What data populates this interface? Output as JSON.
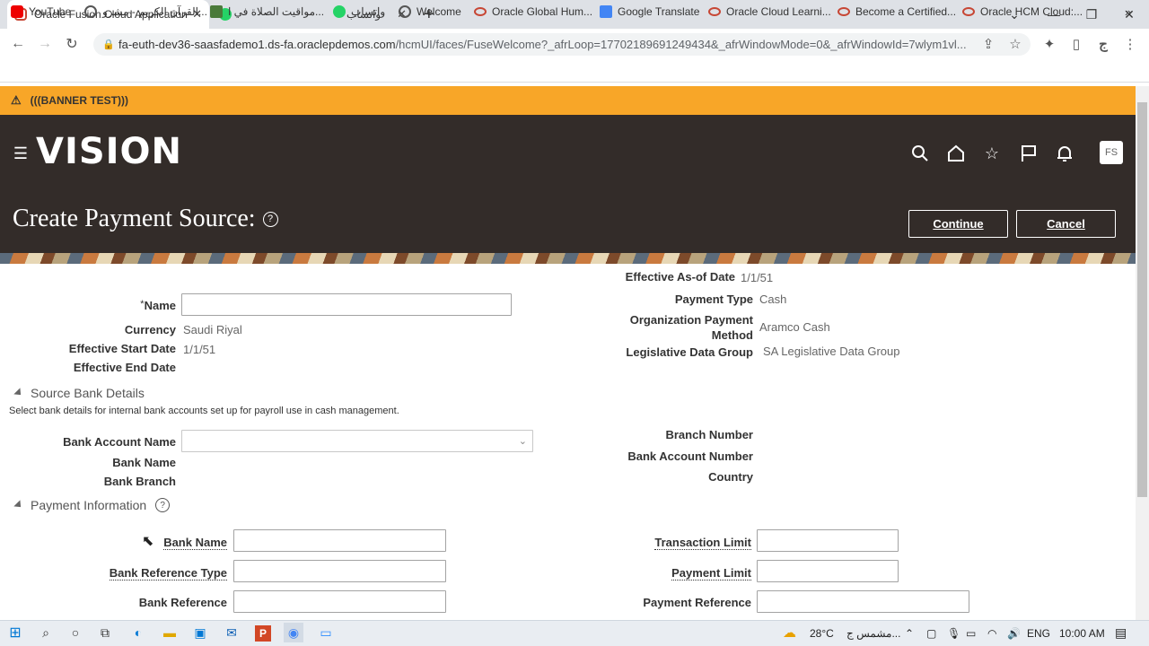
{
  "browser": {
    "tabs": [
      {
        "title": "Oracle Fusion Cloud Applications",
        "active": true
      },
      {
        "title": "واتساب",
        "active": false
      }
    ],
    "new_tab": "+",
    "url_host": "fa-euth-dev36-saasfademo1.ds-fa.oraclepdemos.com",
    "url_path": "/hcmUI/faces/FuseWelcome?_afrLoop=17702189691249434&_afrWindowMode=0&_afrWindowId=7wlym1vl...",
    "profile": "ج",
    "bookmarks": [
      "YouTube",
      "القرآن الكريم - مشرو...",
      "مواقيت الصلاة في ا...",
      "واتساب",
      "Welcome",
      "Oracle Global Hum...",
      "Google Translate",
      "Oracle Cloud Learni...",
      "Become a Certified...",
      "Oracle HCM Cloud:..."
    ]
  },
  "banner": {
    "text": "(((BANNER TEST)))"
  },
  "header": {
    "logo": "VISION",
    "avatar": "FS",
    "page_title": "Create Payment Source:",
    "help": "?",
    "continue_label": "Continue",
    "cancel_label": "Cancel"
  },
  "form": {
    "name_required": "*",
    "name_label": "Name",
    "name_value": "",
    "currency_label": "Currency",
    "currency_value": "Saudi Riyal",
    "eff_start_label": "Effective Start Date",
    "eff_start_value": "1/1/51",
    "eff_end_label": "Effective End Date",
    "eff_asof_label": "Effective As-of Date",
    "eff_asof_value": "1/1/51",
    "payment_type_label": "Payment Type",
    "payment_type_value": "Cash",
    "org_method_label_1": "Organization Payment",
    "org_method_label_2": "Method",
    "org_method_value": "Aramco Cash",
    "ldg_label": "Legislative Data Group",
    "ldg_value": "SA Legislative Data Group"
  },
  "source_bank": {
    "title": "Source Bank Details",
    "description": "Select bank details for internal bank accounts set up for payroll use in cash management.",
    "bank_account_name_label": "Bank Account Name",
    "bank_name_label": "Bank Name",
    "bank_branch_label": "Bank Branch",
    "branch_number_label": "Branch Number",
    "bank_account_number_label": "Bank Account Number",
    "country_label": "Country"
  },
  "payment_info": {
    "title": "Payment Information",
    "help": "?",
    "bank_name_label": "Bank Name",
    "bank_ref_type_label": "Bank Reference Type",
    "bank_ref_label": "Bank Reference",
    "transaction_limit_label": "Transaction Limit",
    "payment_limit_label": "Payment Limit",
    "payment_ref_label": "Payment Reference"
  },
  "taskbar": {
    "weather_temp": "28°C",
    "weather_text": "مشمس ج...",
    "lang": "ENG",
    "time": "10:00 AM"
  },
  "colors": {
    "banner": "#f8a628",
    "header": "#332c29",
    "oracle_red": "#c74634"
  }
}
